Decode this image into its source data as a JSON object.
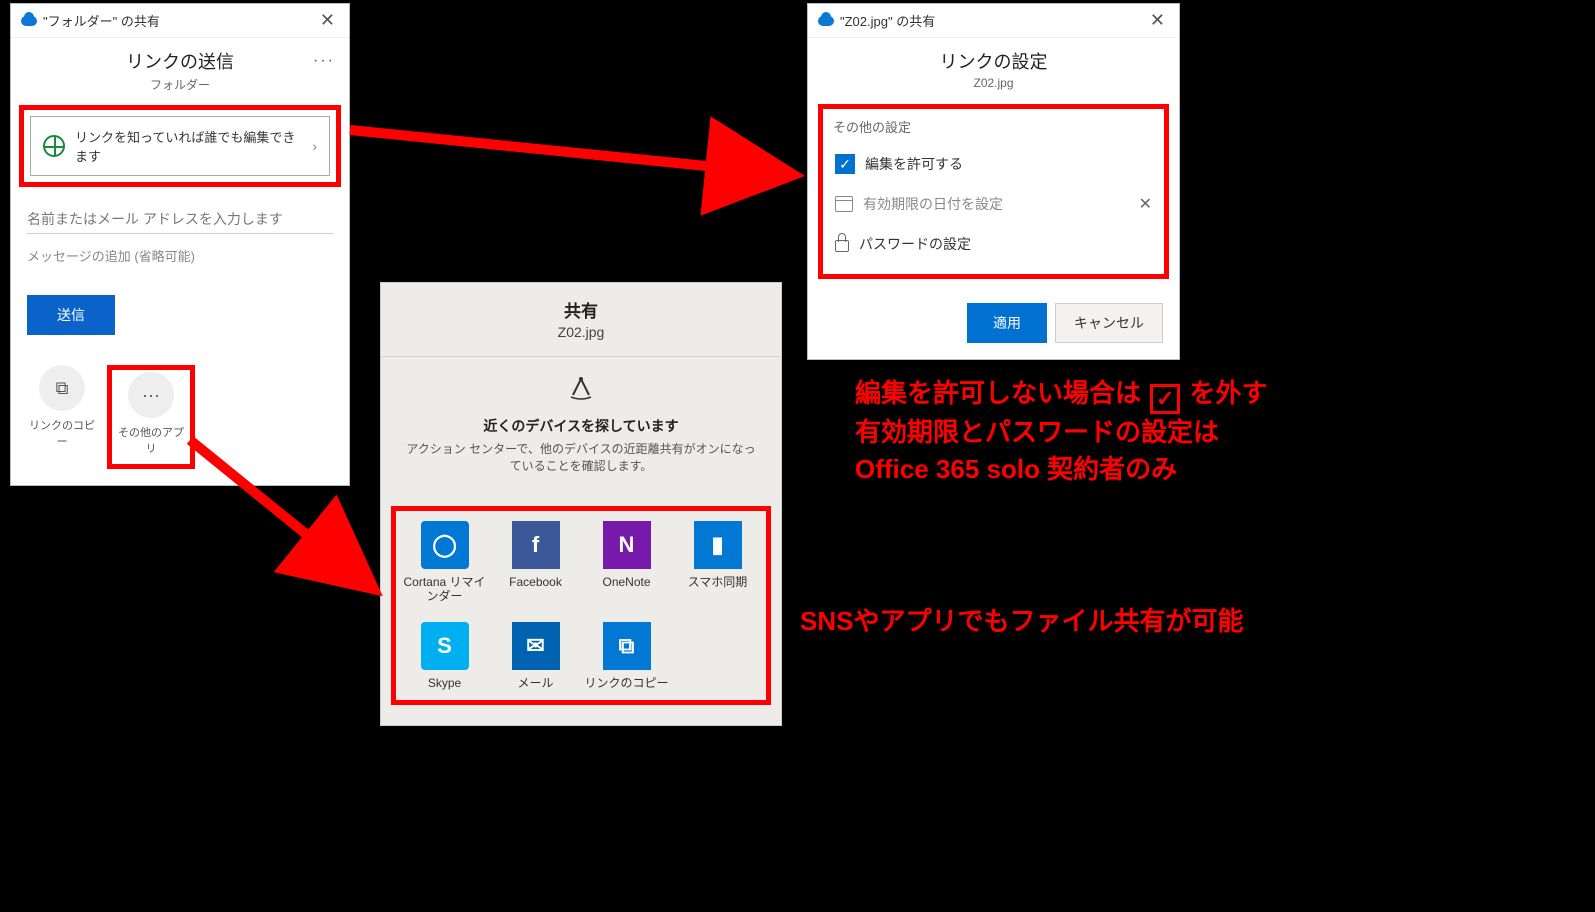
{
  "dialog1": {
    "window_title": "\"フォルダー\" の共有",
    "title": "リンクの送信",
    "subtitle": "フォルダー",
    "scope_label": "リンクを知っていれば誰でも編集できます",
    "name_placeholder": "名前またはメール アドレスを入力します",
    "message_label": "メッセージの追加 (省略可能)",
    "send_label": "送信",
    "copy_link_label": "リンクのコピー",
    "other_apps_label": "その他のアプリ"
  },
  "dialog2": {
    "window_title": "\"Z02.jpg\" の共有",
    "title": "リンクの設定",
    "subtitle": "Z02.jpg",
    "section_label": "その他の設定",
    "allow_edit": "編集を許可する",
    "expiry": "有効期限の日付を設定",
    "password": "パスワードの設定",
    "apply": "適用",
    "cancel": "キャンセル"
  },
  "share_panel": {
    "title": "共有",
    "subtitle": "Z02.jpg",
    "nearby_title": "近くのデバイスを探しています",
    "nearby_desc": "アクション センターで、他のデバイスの近距離共有がオンになっていることを確認します。",
    "apps": [
      {
        "name": "Cortana リマインダー",
        "glyph": "◯",
        "tile": "tile-cortana"
      },
      {
        "name": "Facebook",
        "glyph": "f",
        "tile": "tile-fb"
      },
      {
        "name": "OneNote",
        "glyph": "N",
        "tile": "tile-onenote"
      },
      {
        "name": "スマホ同期",
        "glyph": "▮",
        "tile": "tile-phone"
      },
      {
        "name": "Skype",
        "glyph": "S",
        "tile": "tile-skype"
      },
      {
        "name": "メール",
        "glyph": "✉",
        "tile": "tile-mail"
      },
      {
        "name": "リンクのコピー",
        "glyph": "⧉",
        "tile": "tile-linkcopy"
      }
    ]
  },
  "annotations": {
    "a1_l1": "編集を許可しない場合は",
    "a1_l1b": "を外す",
    "a1_l2": "有効期限とパスワードの設定は",
    "a1_l3": "Office 365 solo 契約者のみ",
    "a2": "SNSやアプリでもファイル共有が可能",
    "check": "✓"
  }
}
